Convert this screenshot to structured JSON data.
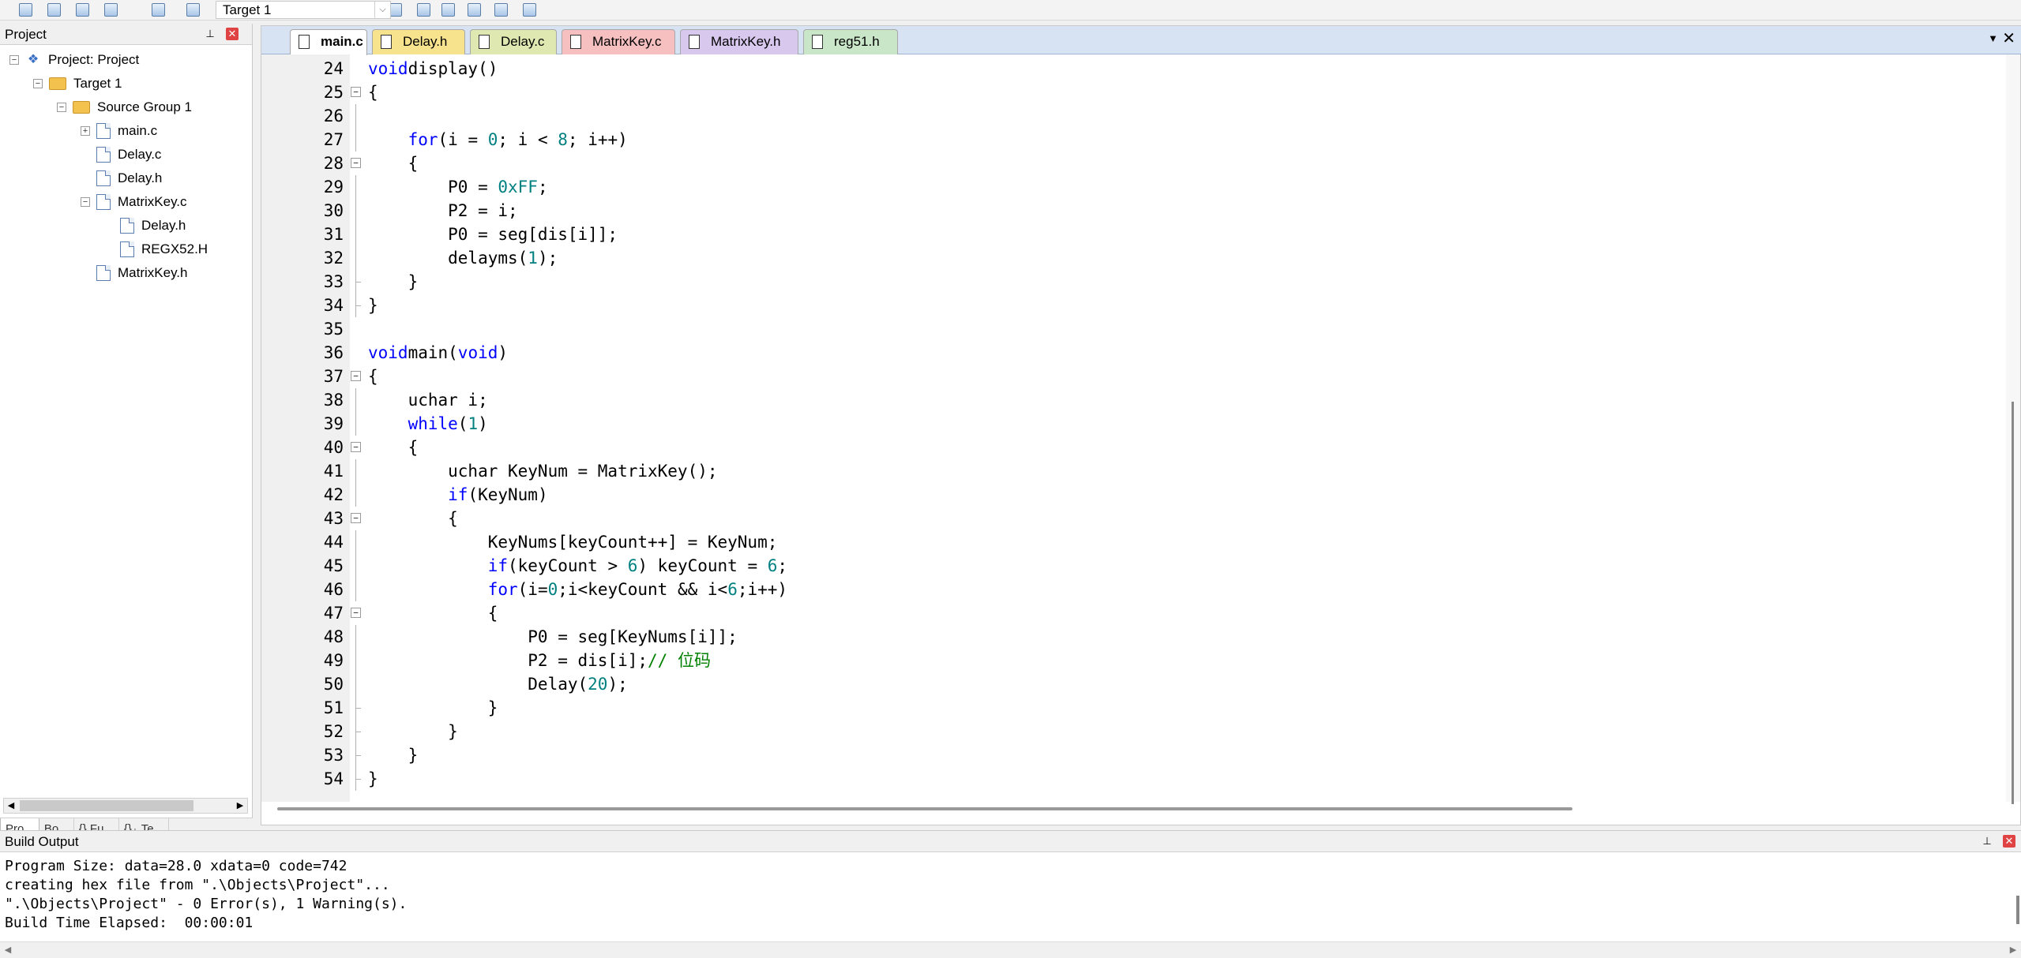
{
  "toolbar": {
    "target_value": "Target 1",
    "icons": [
      "build-icon",
      "rebuild-icon",
      "batch-build-icon",
      "load-icon",
      "translate-icon",
      "stop-build-icon",
      "options-icon",
      "manage-icon",
      "pack-installer-icon",
      "components-icon",
      "manage-runtime-icon",
      "select-packs-icon"
    ]
  },
  "project_panel": {
    "title": "Project",
    "pin": "📌",
    "close": "✕",
    "tree": [
      {
        "label": "Project: Project",
        "level": 0,
        "expand": "−",
        "icon": "proj"
      },
      {
        "label": "Target 1",
        "level": 1,
        "expand": "−",
        "icon": "folder"
      },
      {
        "label": "Source Group 1",
        "level": 2,
        "expand": "−",
        "icon": "folder"
      },
      {
        "label": "main.c",
        "level": 3,
        "expand": "+",
        "icon": "file"
      },
      {
        "label": "Delay.c",
        "level": 3,
        "expand": "",
        "icon": "file"
      },
      {
        "label": "Delay.h",
        "level": 3,
        "expand": "",
        "icon": "file"
      },
      {
        "label": "MatrixKey.c",
        "level": 3,
        "expand": "−",
        "icon": "file"
      },
      {
        "label": "Delay.h",
        "level": 4,
        "expand": "",
        "icon": "file"
      },
      {
        "label": "REGX52.H",
        "level": 4,
        "expand": "",
        "icon": "file"
      },
      {
        "label": "MatrixKey.h",
        "level": 3,
        "expand": "",
        "icon": "file"
      }
    ],
    "tabs": [
      "Pro...",
      "Bo...",
      "{} Fu...",
      "{}₊ Te..."
    ]
  },
  "editor": {
    "tabs": [
      {
        "label": "main.c",
        "color": "#ffffff",
        "active": true
      },
      {
        "label": "Delay.h",
        "color": "#f7e38d",
        "active": false
      },
      {
        "label": "Delay.c",
        "color": "#dfe8b0",
        "active": false
      },
      {
        "label": "MatrixKey.c",
        "color": "#f7c0c0",
        "active": false
      },
      {
        "label": "MatrixKey.h",
        "color": "#d8c8ee",
        "active": false
      },
      {
        "label": "reg51.h",
        "color": "#c9e6c9",
        "active": false
      }
    ],
    "tab_menu": "▼",
    "tab_close": "✕",
    "lines": [
      {
        "n": "24",
        "fold": "",
        "guide": "",
        "segs": [
          [
            "kw",
            "void"
          ],
          [
            "",
            "display()"
          ]
        ]
      },
      {
        "n": "25",
        "fold": "−",
        "guide": "",
        "segs": [
          [
            "",
            "{"
          ]
        ]
      },
      {
        "n": "26",
        "fold": "",
        "guide": "line",
        "segs": []
      },
      {
        "n": "27",
        "fold": "",
        "guide": "line",
        "segs": [
          [
            "",
            "    "
          ],
          [
            "kw",
            "for"
          ],
          [
            "",
            "(i = "
          ],
          [
            "num",
            "0"
          ],
          [
            "",
            "; i < "
          ],
          [
            "num",
            "8"
          ],
          [
            "",
            "; i++)"
          ]
        ]
      },
      {
        "n": "28",
        "fold": "−",
        "guide": "",
        "segs": [
          [
            "",
            "    {"
          ]
        ]
      },
      {
        "n": "29",
        "fold": "",
        "guide": "line",
        "segs": [
          [
            "",
            "        P0 = "
          ],
          [
            "num",
            "0xFF"
          ],
          [
            "",
            ";"
          ]
        ]
      },
      {
        "n": "30",
        "fold": "",
        "guide": "line",
        "segs": [
          [
            "",
            "        P2 = i;"
          ]
        ]
      },
      {
        "n": "31",
        "fold": "",
        "guide": "line",
        "segs": [
          [
            "",
            "        P0 = seg[dis[i]];"
          ]
        ]
      },
      {
        "n": "32",
        "fold": "",
        "guide": "line",
        "segs": [
          [
            "",
            "        delayms("
          ],
          [
            "num",
            "1"
          ],
          [
            "",
            ");"
          ]
        ]
      },
      {
        "n": "33",
        "fold": "",
        "guide": "end",
        "segs": [
          [
            "",
            "    }"
          ]
        ]
      },
      {
        "n": "34",
        "fold": "",
        "guide": "end",
        "segs": [
          [
            "",
            "}"
          ]
        ]
      },
      {
        "n": "35",
        "fold": "",
        "guide": "",
        "segs": []
      },
      {
        "n": "36",
        "fold": "",
        "guide": "",
        "segs": [
          [
            "kw",
            "void"
          ],
          [
            "",
            "main("
          ],
          [
            "kw",
            "void"
          ],
          [
            "",
            ")"
          ]
        ]
      },
      {
        "n": "37",
        "fold": "−",
        "guide": "",
        "segs": [
          [
            "",
            "{"
          ]
        ]
      },
      {
        "n": "38",
        "fold": "",
        "guide": "line",
        "segs": [
          [
            "",
            "    uchar i;"
          ]
        ]
      },
      {
        "n": "39",
        "fold": "",
        "guide": "line",
        "segs": [
          [
            "",
            "    "
          ],
          [
            "kw",
            "while"
          ],
          [
            "",
            "("
          ],
          [
            "num",
            "1"
          ],
          [
            "",
            ")"
          ]
        ]
      },
      {
        "n": "40",
        "fold": "−",
        "guide": "",
        "segs": [
          [
            "",
            "    {"
          ]
        ]
      },
      {
        "n": "41",
        "fold": "",
        "guide": "line",
        "segs": [
          [
            "",
            "        uchar KeyNum = MatrixKey();"
          ]
        ]
      },
      {
        "n": "42",
        "fold": "",
        "guide": "line",
        "segs": [
          [
            "",
            "        "
          ],
          [
            "kw",
            "if"
          ],
          [
            "",
            "(KeyNum)"
          ]
        ]
      },
      {
        "n": "43",
        "fold": "−",
        "guide": "",
        "segs": [
          [
            "",
            "        {"
          ]
        ]
      },
      {
        "n": "44",
        "fold": "",
        "guide": "line",
        "segs": [
          [
            "",
            "            KeyNums[keyCount++] = KeyNum;"
          ]
        ]
      },
      {
        "n": "45",
        "fold": "",
        "guide": "line",
        "segs": [
          [
            "",
            "            "
          ],
          [
            "kw",
            "if"
          ],
          [
            "",
            "(keyCount > "
          ],
          [
            "num",
            "6"
          ],
          [
            "",
            ") keyCount = "
          ],
          [
            "num",
            "6"
          ],
          [
            "",
            ";"
          ]
        ]
      },
      {
        "n": "46",
        "fold": "",
        "guide": "line",
        "segs": [
          [
            "",
            "            "
          ],
          [
            "kw",
            "for"
          ],
          [
            "",
            "(i="
          ],
          [
            "num",
            "0"
          ],
          [
            "",
            ";i<keyCount && i<"
          ],
          [
            "num",
            "6"
          ],
          [
            "",
            ";i++)"
          ]
        ]
      },
      {
        "n": "47",
        "fold": "−",
        "guide": "",
        "segs": [
          [
            "",
            "            {"
          ]
        ]
      },
      {
        "n": "48",
        "fold": "",
        "guide": "line",
        "segs": [
          [
            "",
            "                P0 = seg[KeyNums[i]];"
          ]
        ]
      },
      {
        "n": "49",
        "fold": "",
        "guide": "line",
        "segs": [
          [
            "",
            "                P2 = dis[i];"
          ],
          [
            "cm",
            "// 位码"
          ]
        ]
      },
      {
        "n": "50",
        "fold": "",
        "guide": "line",
        "segs": [
          [
            "",
            "                Delay("
          ],
          [
            "num",
            "20"
          ],
          [
            "",
            ");"
          ]
        ]
      },
      {
        "n": "51",
        "fold": "",
        "guide": "end",
        "segs": [
          [
            "",
            "            }"
          ]
        ]
      },
      {
        "n": "52",
        "fold": "",
        "guide": "end",
        "segs": [
          [
            "",
            "        }"
          ]
        ]
      },
      {
        "n": "53",
        "fold": "",
        "guide": "end",
        "segs": [
          [
            "",
            "    }"
          ]
        ]
      },
      {
        "n": "54",
        "fold": "",
        "guide": "end",
        "segs": [
          [
            "",
            "}"
          ]
        ]
      }
    ]
  },
  "build_output": {
    "title": "Build Output",
    "pin": "📌",
    "close": "✕",
    "lines": [
      "Program Size: data=28.0 xdata=0 code=742",
      "creating hex file from \".\\Objects\\Project\"...",
      "\".\\Objects\\Project\" - 0 Error(s), 1 Warning(s).",
      "Build Time Elapsed:  00:00:01"
    ]
  }
}
